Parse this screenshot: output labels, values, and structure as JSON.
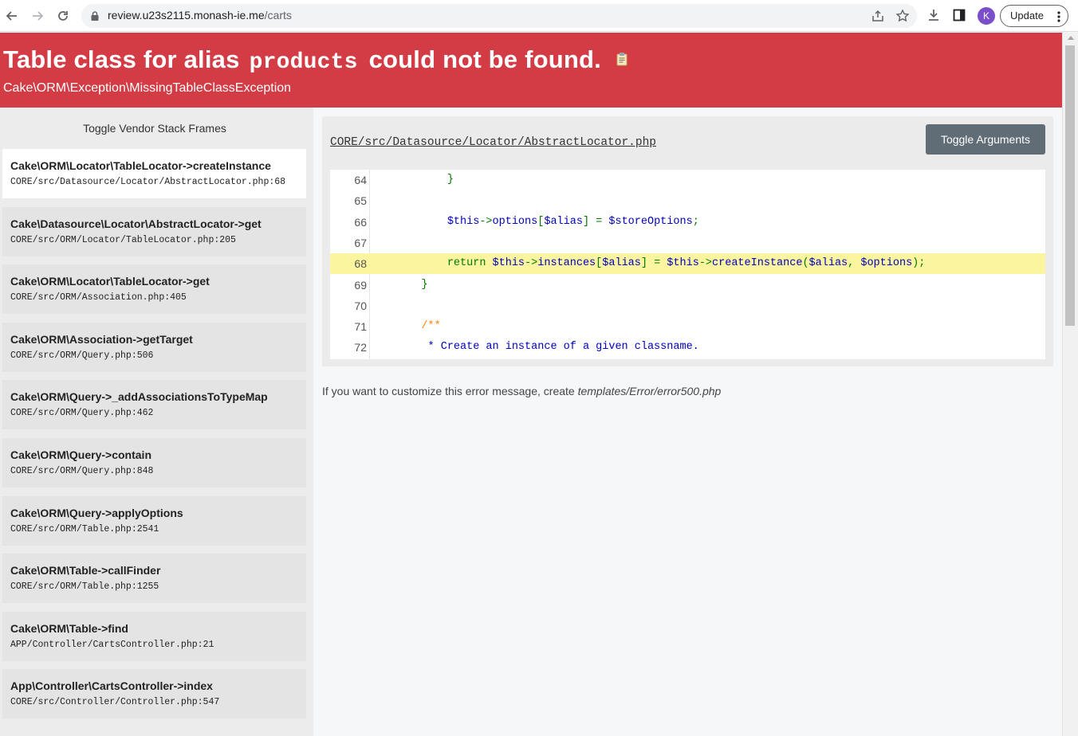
{
  "browser": {
    "url_host": "review.u23s2115.monash-ie.me",
    "url_path": "/carts",
    "avatar_letter": "K",
    "update_label": "Update"
  },
  "error": {
    "title_prefix": "Table class for alias",
    "title_alias": "products",
    "title_suffix": "could not be found.",
    "exception_class": "Cake\\ORM\\Exception\\MissingTableClassException"
  },
  "stack": {
    "toggle_vendor_label": "Toggle Vendor Stack Frames",
    "frames": [
      {
        "fn": "Cake\\ORM\\Locator\\TableLocator->createInstance",
        "file": "CORE/src/Datasource/Locator/AbstractLocator.php:68",
        "active": true
      },
      {
        "fn": "Cake\\Datasource\\Locator\\AbstractLocator->get",
        "file": "CORE/src/ORM/Locator/TableLocator.php:205",
        "active": false
      },
      {
        "fn": "Cake\\ORM\\Locator\\TableLocator->get",
        "file": "CORE/src/ORM/Association.php:405",
        "active": false
      },
      {
        "fn": "Cake\\ORM\\Association->getTarget",
        "file": "CORE/src/ORM/Query.php:506",
        "active": false
      },
      {
        "fn": "Cake\\ORM\\Query->_addAssociationsToTypeMap",
        "file": "CORE/src/ORM/Query.php:462",
        "active": false
      },
      {
        "fn": "Cake\\ORM\\Query->contain",
        "file": "CORE/src/ORM/Query.php:848",
        "active": false
      },
      {
        "fn": "Cake\\ORM\\Query->applyOptions",
        "file": "CORE/src/ORM/Table.php:2541",
        "active": false
      },
      {
        "fn": "Cake\\ORM\\Table->callFinder",
        "file": "CORE/src/ORM/Table.php:1255",
        "active": false
      },
      {
        "fn": "Cake\\ORM\\Table->find",
        "file": "APP/Controller/CartsController.php:21",
        "active": false
      },
      {
        "fn": "App\\Controller\\CartsController->index",
        "file": "CORE/src/Controller/Controller.php:547",
        "active": false
      }
    ]
  },
  "code": {
    "file_path": "CORE/src/Datasource/Locator/AbstractLocator.php",
    "toggle_args_label": "Toggle Arguments",
    "highlight_line": "68",
    "lines": [
      {
        "no": "64",
        "indent": "        ",
        "parts": [
          {
            "t": "}",
            "c": "green"
          }
        ]
      },
      {
        "no": "65",
        "indent": "",
        "parts": []
      },
      {
        "no": "66",
        "indent": "        ",
        "parts": [
          {
            "t": "$this",
            "c": "blue"
          },
          {
            "t": "->",
            "c": "green"
          },
          {
            "t": "options",
            "c": "blue"
          },
          {
            "t": "[",
            "c": "green"
          },
          {
            "t": "$alias",
            "c": "blue"
          },
          {
            "t": "] = ",
            "c": "green"
          },
          {
            "t": "$storeOptions",
            "c": "blue"
          },
          {
            "t": ";",
            "c": "green"
          }
        ]
      },
      {
        "no": "67",
        "indent": "",
        "parts": []
      },
      {
        "no": "68",
        "indent": "        ",
        "parts": [
          {
            "t": "return ",
            "c": "green"
          },
          {
            "t": "$this",
            "c": "blue"
          },
          {
            "t": "->",
            "c": "green"
          },
          {
            "t": "instances",
            "c": "blue"
          },
          {
            "t": "[",
            "c": "green"
          },
          {
            "t": "$alias",
            "c": "blue"
          },
          {
            "t": "] = ",
            "c": "green"
          },
          {
            "t": "$this",
            "c": "blue"
          },
          {
            "t": "->",
            "c": "green"
          },
          {
            "t": "createInstance",
            "c": "blue"
          },
          {
            "t": "(",
            "c": "green"
          },
          {
            "t": "$alias",
            "c": "blue"
          },
          {
            "t": ", ",
            "c": "green"
          },
          {
            "t": "$options",
            "c": "blue"
          },
          {
            "t": ");",
            "c": "green"
          }
        ]
      },
      {
        "no": "69",
        "indent": "    ",
        "parts": [
          {
            "t": "}",
            "c": "green"
          }
        ]
      },
      {
        "no": "70",
        "indent": "",
        "parts": []
      },
      {
        "no": "71",
        "indent": "    ",
        "parts": [
          {
            "t": "/**",
            "c": "orange"
          }
        ]
      },
      {
        "no": "72",
        "indent": "     ",
        "parts": [
          {
            "t": "* Create an instance of a given classname.",
            "c": "blue"
          }
        ]
      }
    ]
  },
  "footer": {
    "customize_text": "If you want to customize this error message, create ",
    "customize_path": "templates/Error/error500.php"
  },
  "colors": {
    "error_red": "#d33c44",
    "button_gray": "#606c76",
    "highlight_yellow": "#fbf5a0"
  }
}
